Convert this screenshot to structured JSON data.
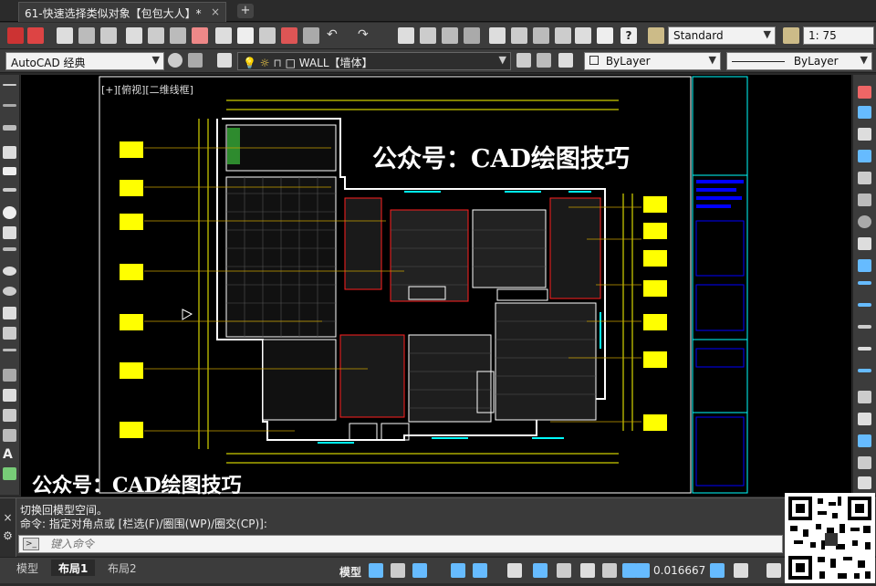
{
  "document_tab": {
    "title": "61-快速选择类似对象【包包大人】*",
    "close": "×",
    "add": "+"
  },
  "toolbar": {
    "text_style": "Standard",
    "scale": "1: 75",
    "workspace": "AutoCAD 经典",
    "layer": "WALL【墙体】",
    "color": "ByLayer",
    "linetype": "ByLayer"
  },
  "canvas": {
    "view_label": "[+][俯视][二维线框]",
    "watermark_top": "公众号：CAD绘图技巧",
    "watermark_bottom": "公众号：CAD绘图技巧"
  },
  "command": {
    "history": [
      "切换回模型空间。",
      "命令: 指定对角点或 [栏选(F)/圈围(WP)/圈交(CP)]:"
    ],
    "placeholder": "键入命令",
    "prompt_icon": ">_",
    "close": "×"
  },
  "status": {
    "tabs": [
      "模型",
      "布局1",
      "布局2"
    ],
    "active_tab": "布局1",
    "mode_label": "模型",
    "annotation_scale": "0.016667"
  },
  "colors": {
    "canvas_bg": "#000000",
    "wall": "#ffffff",
    "dim": "#ffff00",
    "cyan": "#00ffff",
    "red": "#ff2020",
    "hatch": "#c0c0c0",
    "title_blue": "#0000ff"
  },
  "icons": {
    "workspace_gear": "gear-icon",
    "layer_lightbulb": "lightbulb-icon",
    "undo": "undo-icon",
    "redo": "redo-icon",
    "pan": "pan-hand-icon",
    "help": "help-icon",
    "cursor": "arrow-cursor-icon"
  }
}
